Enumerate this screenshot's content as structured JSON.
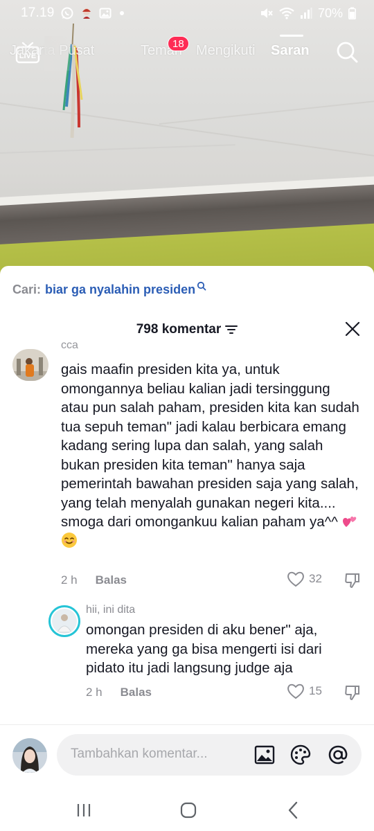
{
  "status_bar": {
    "time": "17.19",
    "battery": "70%"
  },
  "top_nav": {
    "tabs": [
      {
        "label": "Jakarta Pusat",
        "active": false
      },
      {
        "label": "Teman",
        "active": false
      },
      {
        "label": "Mengikuti",
        "active": false
      },
      {
        "label": "Saran",
        "active": true
      }
    ],
    "friends_badge": "18",
    "live_label": "LIVE"
  },
  "comments_sheet": {
    "search_prefix": "Cari:",
    "search_term": "biar ga nyalahin presiden",
    "comment_count": "798 komentar",
    "comments": [
      {
        "username": "cca",
        "text": "gais maafin presiden kita ya, untuk omongannya beliau kalian jadi tersinggung atau pun salah paham, presiden kita kan sudah tua sepuh teman\" jadi kalau berbicara emang kadang sering lupa dan salah, yang salah bukan presiden kita teman\" hanya saja pemerintah bawahan presiden saja yang salah, yang telah menyalah gunakan negeri kita....\nsmoga dari omongankuu kalian paham ya^^",
        "time": "2 h",
        "reply_label": "Balas",
        "likes": "32"
      },
      {
        "username": "hii, ini dita",
        "text": "omongan presiden di aku bener\" aja, mereka yang ga bisa mengerti isi dari pidato itu jadi langsung judge aja",
        "time": "2 h",
        "reply_label": "Balas",
        "likes": "15"
      }
    ],
    "input_placeholder": "Tambahkan komentar..."
  },
  "colors": {
    "accent_badge": "#fe2c55",
    "search_term": "#2b5db5",
    "muted": "#8a8b91"
  }
}
